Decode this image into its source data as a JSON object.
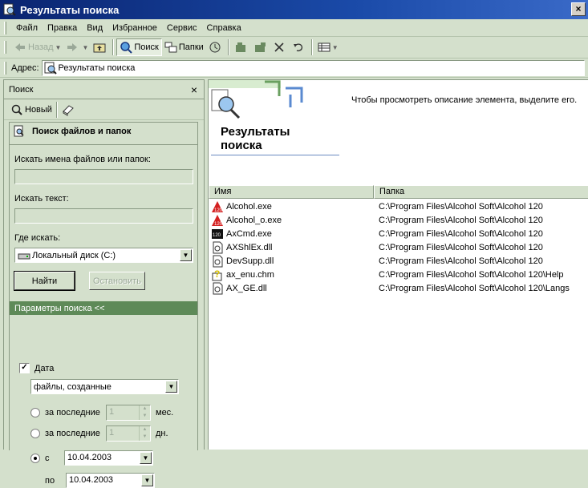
{
  "window": {
    "title": "Результаты поиска",
    "close_label": "×"
  },
  "menubar": {
    "items": [
      {
        "label": "Файл"
      },
      {
        "label": "Правка"
      },
      {
        "label": "Вид"
      },
      {
        "label": "Избранное"
      },
      {
        "label": "Сервис"
      },
      {
        "label": "Справка"
      }
    ]
  },
  "toolbar": {
    "back_label": "Назад",
    "search_label": "Поиск",
    "folders_label": "Папки"
  },
  "address": {
    "label": "Адрес:",
    "value": "Результаты поиска"
  },
  "search_pane": {
    "header": "Поиск",
    "close_label": "×",
    "new_label": "Новый",
    "title": "Поиск файлов и папок",
    "names_label": "Искать имена файлов или папок:",
    "names_value": "",
    "text_label": "Искать текст:",
    "text_value": "",
    "where_label": "Где искать:",
    "where_value": "Локальный диск (C:)",
    "find_button": "Найти",
    "stop_button": "Остановить",
    "options_header": "Параметры поиска <<",
    "date_checkbox_label": "Дата",
    "date_checked": true,
    "date_type": "файлы, созданные",
    "last_months_label": "за последние",
    "last_months_value": "1",
    "months_unit": "мес.",
    "last_days_label": "за последние",
    "last_days_value": "1",
    "days_unit": "дн.",
    "from_label": "с",
    "from_value": "10.04.2003",
    "to_label": "по",
    "to_value": "10.04.2003"
  },
  "results": {
    "banner_title_line1": "Результаты",
    "banner_title_line2": "поиска",
    "description": "Чтобы просмотреть описание элемента, выделите его.",
    "columns": {
      "name": "Имя",
      "folder": "Папка"
    },
    "rows": [
      {
        "name": "Alcohol.exe",
        "folder": "C:\\Program Files\\Alcohol Soft\\Alcohol 120",
        "icon": "alcohol-exe-icon"
      },
      {
        "name": "Alcohol_o.exe",
        "folder": "C:\\Program Files\\Alcohol Soft\\Alcohol 120",
        "icon": "alcohol-exe-icon"
      },
      {
        "name": "AxCmd.exe",
        "folder": "C:\\Program Files\\Alcohol Soft\\Alcohol 120",
        "icon": "axcmd-exe-icon"
      },
      {
        "name": "AXShlEx.dll",
        "folder": "C:\\Program Files\\Alcohol Soft\\Alcohol 120",
        "icon": "dll-file-icon"
      },
      {
        "name": "DevSupp.dll",
        "folder": "C:\\Program Files\\Alcohol Soft\\Alcohol 120",
        "icon": "dll-file-icon"
      },
      {
        "name": "ax_enu.chm",
        "folder": "C:\\Program Files\\Alcohol Soft\\Alcohol 120\\Help",
        "icon": "help-file-icon"
      },
      {
        "name": "AX_GE.dll",
        "folder": "C:\\Program Files\\Alcohol Soft\\Alcohol 120\\Langs",
        "icon": "dll-file-icon"
      }
    ]
  }
}
